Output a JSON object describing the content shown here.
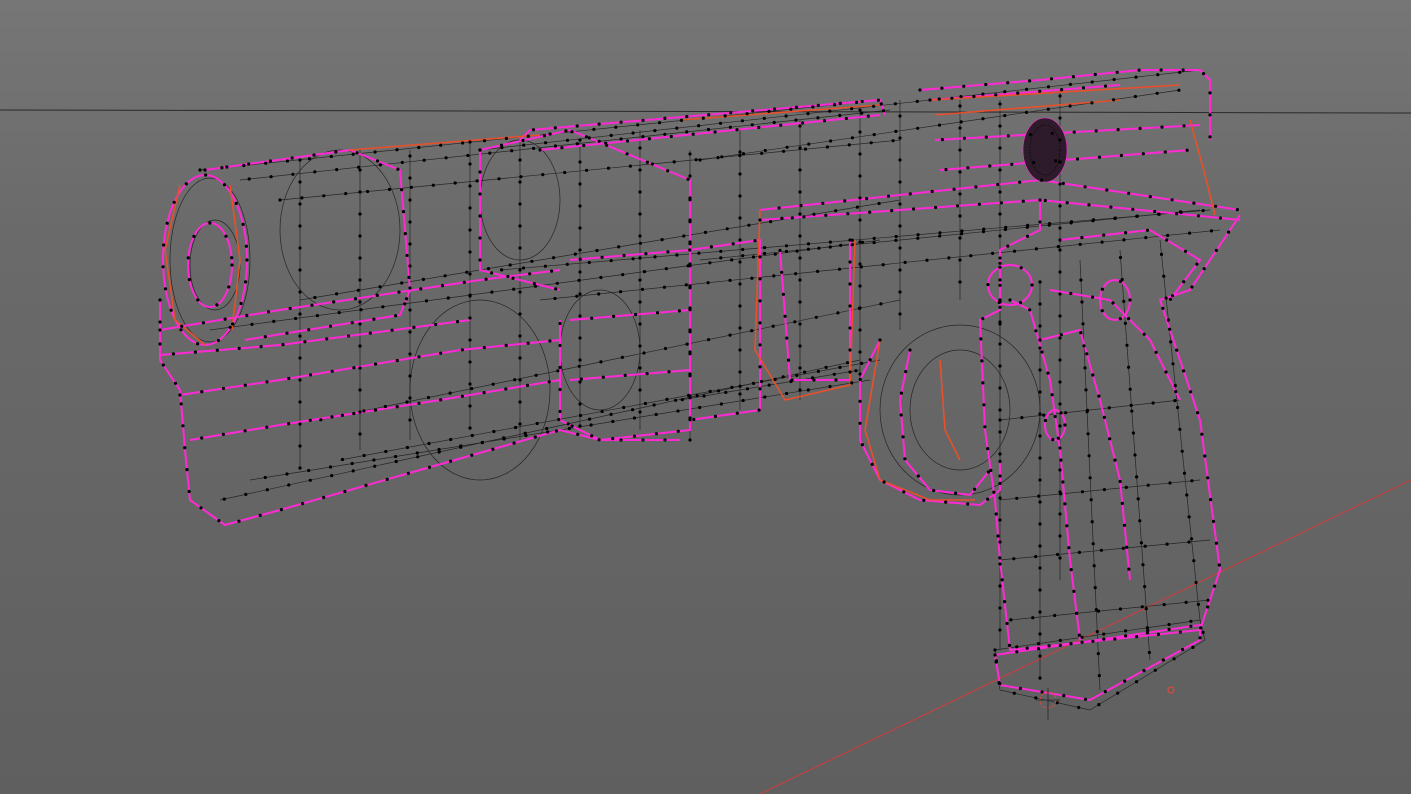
{
  "viewport": {
    "background_top": "#767676",
    "background_bottom": "#5f5f5f"
  },
  "colors": {
    "selected_edge": "#ff2ad6",
    "seam_edge": "#e8502c",
    "wire_edge": "#1a1a1a",
    "vertex": "#000000",
    "horizon_line": "#2a2a2a",
    "x_axis_line": "#d23c3c",
    "origin_marker": "#e04a3a"
  },
  "icons": {
    "cursor": "3d-cursor-icon",
    "origin": "origin-icon"
  },
  "mesh": {
    "object": "pistol-wireframe",
    "display_mode": "edit-mode-wireframe"
  }
}
